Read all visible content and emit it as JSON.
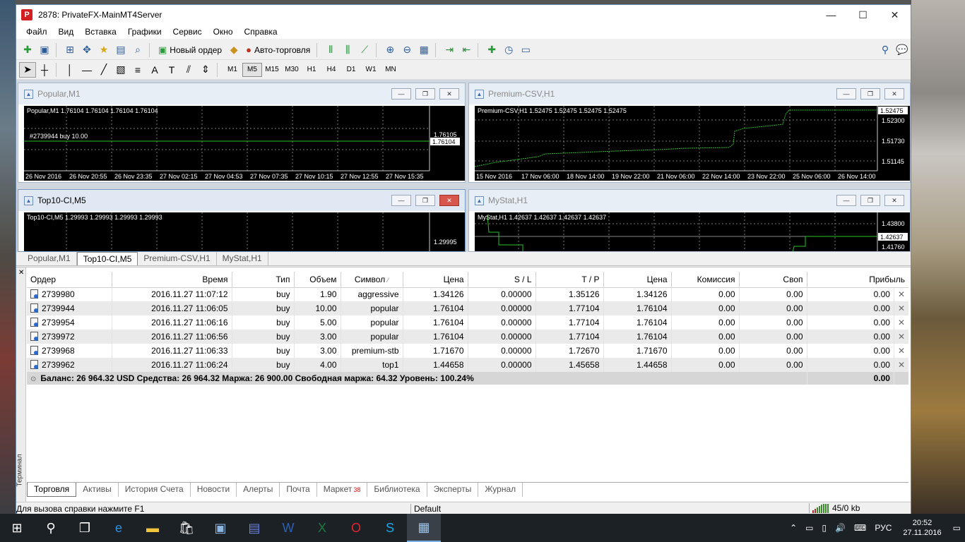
{
  "window": {
    "title": "2878: PrivateFX-MainMT4Server",
    "icon_letter": "P",
    "min": "—",
    "max": "☐",
    "close": "✕"
  },
  "menu": [
    "Файл",
    "Вид",
    "Вставка",
    "Графики",
    "Сервис",
    "Окно",
    "Справка"
  ],
  "toolbar": {
    "new_order": "Новый ордер",
    "autotrading": "Авто-торговля"
  },
  "timeframes": [
    "M1",
    "M5",
    "M15",
    "M30",
    "H1",
    "H4",
    "D1",
    "W1",
    "MN"
  ],
  "active_timeframe": "M5",
  "charts": [
    {
      "title": "Popular,M1",
      "header": "Popular,M1  1.76104 1.76104 1.76104 1.76104",
      "order_label": "#2739944 buy 10.00",
      "price_labels": [
        "1.76105",
        "1.76104"
      ],
      "time_labels": [
        "26 Nov 2016",
        "26 Nov 20:55",
        "26 Nov 23:35",
        "27 Nov 02:15",
        "27 Nov 04:53",
        "27 Nov 07:35",
        "27 Nov 10:15",
        "27 Nov 12:55",
        "27 Nov 15:35"
      ]
    },
    {
      "title": "Premium-CSV,H1",
      "header": "Premium-CSV,H1  1.52475 1.52475 1.52475 1.52475",
      "price_labels": [
        "1.52475",
        "1.52300",
        "1.51730",
        "1.51145"
      ],
      "time_labels": [
        "15 Nov 2016",
        "17 Nov 06:00",
        "18 Nov 14:00",
        "19 Nov 22:00",
        "21 Nov 06:00",
        "22 Nov 14:00",
        "23 Nov 22:00",
        "25 Nov 06:00",
        "26 Nov 14:00"
      ]
    },
    {
      "title": "Top10-CI,M5",
      "header": "Top10-CI,M5  1.29993 1.29993 1.29993 1.29993",
      "price_labels": [
        "1.29995"
      ]
    },
    {
      "title": "MyStat,H1",
      "header": "MyStat,H1  1.42637 1.42637 1.42637 1.42637",
      "price_labels": [
        "1.43800",
        "1.42637",
        "1.41760"
      ]
    }
  ],
  "chart_tabs": [
    "Popular,M1",
    "Top10-CI,M5",
    "Premium-CSV,H1",
    "MyStat,H1"
  ],
  "active_chart_tab": "Top10-CI,M5",
  "terminal": {
    "side_label": "Терминал",
    "columns": [
      "Ордер",
      "Время",
      "Тип",
      "Объем",
      "Символ",
      "Цена",
      "S / L",
      "T / P",
      "Цена",
      "Комиссия",
      "Своп",
      "Прибыль"
    ],
    "sort_mark": "⁄",
    "rows": [
      {
        "order": "2739980",
        "time": "2016.11.27 11:07:12",
        "type": "buy",
        "volume": "1.90",
        "symbol": "aggressive",
        "price": "1.34126",
        "sl": "0.00000",
        "tp": "1.35126",
        "cur": "1.34126",
        "commission": "0.00",
        "swap": "0.00",
        "profit": "0.00"
      },
      {
        "order": "2739944",
        "time": "2016.11.27 11:06:05",
        "type": "buy",
        "volume": "10.00",
        "symbol": "popular",
        "price": "1.76104",
        "sl": "0.00000",
        "tp": "1.77104",
        "cur": "1.76104",
        "commission": "0.00",
        "swap": "0.00",
        "profit": "0.00"
      },
      {
        "order": "2739954",
        "time": "2016.11.27 11:06:16",
        "type": "buy",
        "volume": "5.00",
        "symbol": "popular",
        "price": "1.76104",
        "sl": "0.00000",
        "tp": "1.77104",
        "cur": "1.76104",
        "commission": "0.00",
        "swap": "0.00",
        "profit": "0.00"
      },
      {
        "order": "2739972",
        "time": "2016.11.27 11:06:56",
        "type": "buy",
        "volume": "3.00",
        "symbol": "popular",
        "price": "1.76104",
        "sl": "0.00000",
        "tp": "1.77104",
        "cur": "1.76104",
        "commission": "0.00",
        "swap": "0.00",
        "profit": "0.00"
      },
      {
        "order": "2739968",
        "time": "2016.11.27 11:06:33",
        "type": "buy",
        "volume": "3.00",
        "symbol": "premium-stb",
        "price": "1.71670",
        "sl": "0.00000",
        "tp": "1.72670",
        "cur": "1.71670",
        "commission": "0.00",
        "swap": "0.00",
        "profit": "0.00"
      },
      {
        "order": "2739962",
        "time": "2016.11.27 11:06:24",
        "type": "buy",
        "volume": "4.00",
        "symbol": "top1",
        "price": "1.44658",
        "sl": "0.00000",
        "tp": "1.45658",
        "cur": "1.44658",
        "commission": "0.00",
        "swap": "0.00",
        "profit": "0.00"
      }
    ],
    "balance_line": "Баланс: 26 964.32 USD  Средства: 26 964.32  Маржа: 26 900.00  Свободная маржа: 64.32  Уровень: 100.24%",
    "balance_profit": "0.00",
    "tabs": [
      "Торговля",
      "Активы",
      "История Счета",
      "Новости",
      "Алерты",
      "Почта",
      "Маркет",
      "Библиотека",
      "Эксперты",
      "Журнал"
    ],
    "market_badge": "38"
  },
  "status": {
    "help": "Для вызова справки нажмите F1",
    "profile": "Default",
    "traffic": "45/0 kb"
  },
  "taskbar": {
    "lang": "РУС",
    "time": "20:52",
    "date": "27.11.2016"
  }
}
